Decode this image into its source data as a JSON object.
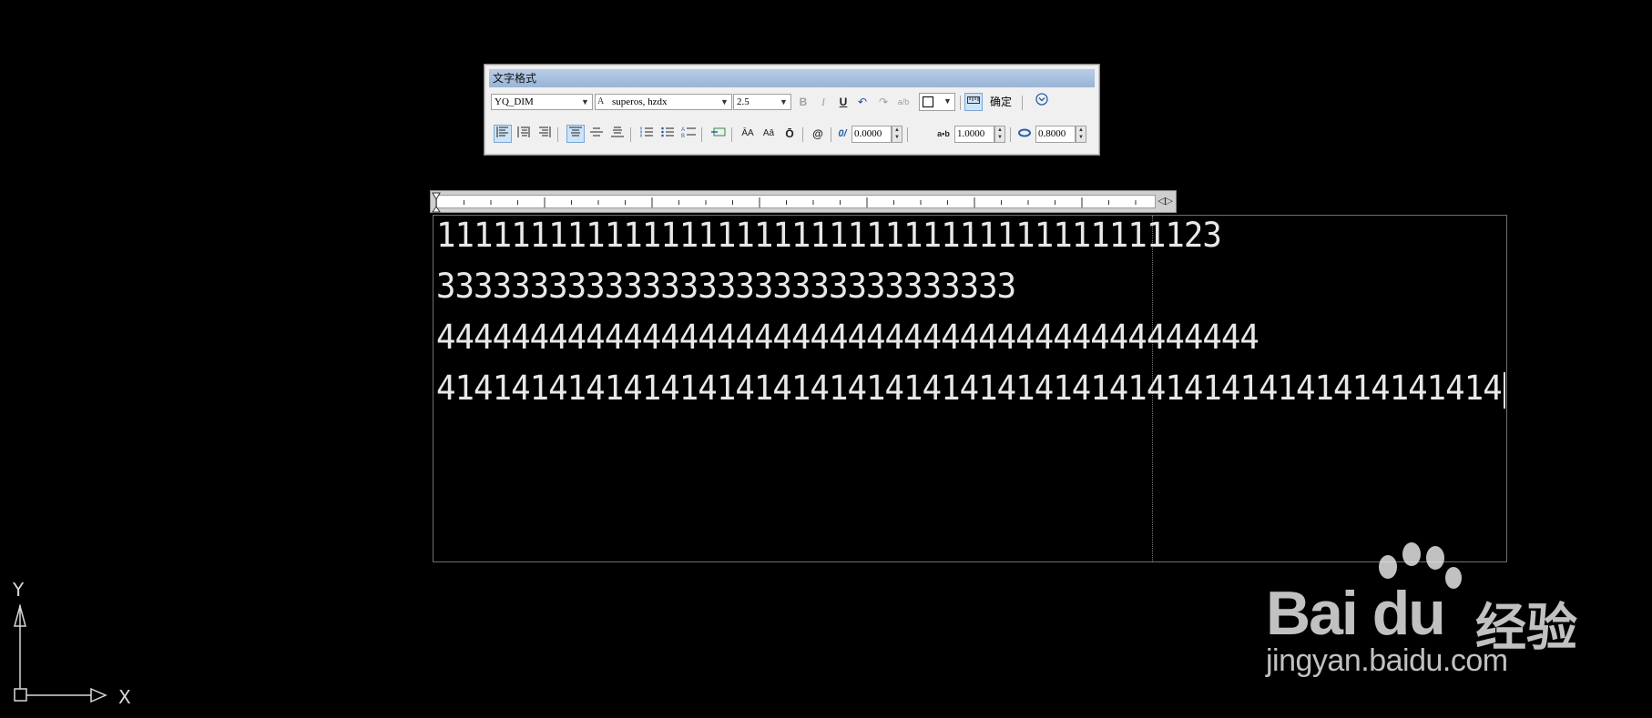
{
  "toolbar": {
    "title": "文字格式",
    "style_value": "YQ_DIM",
    "font_value": "superos, hzdx",
    "font_prefix": "A",
    "height_value": "2.5",
    "bold": "B",
    "italic": "I",
    "underline": "U",
    "undo": "↶",
    "redo": "↷",
    "stack": "a/b",
    "ok_label": "确定",
    "oblique_value": "0.0000",
    "tracking_value": "1.0000",
    "width_value": "0.8000",
    "tracking_icon_label": "a•b",
    "oblique_icon_label": "0/",
    "at_symbol": "@",
    "uppercase_icon": "ĀA",
    "lowercase_icon": "Aā",
    "overline_icon": "Ō"
  },
  "ruler": {
    "right_marker": "◁▷"
  },
  "editor": {
    "lines": [
      "111111111111111111111111111111111111111123",
      "3333333333333333333333333333333",
      "44444444444444444444444444444444444444444444",
      "414141414141414141414141414141414141414141414141414141414"
    ]
  },
  "ucs": {
    "x_label": "X",
    "y_label": "Y"
  },
  "watermark": {
    "logo": "Bai du",
    "chinese": "经验",
    "url": "jingyan.baidu.com"
  },
  "colors": {
    "background": "#000000",
    "text": "#e8e8e8",
    "toolbar_title": "#99b4d6"
  }
}
